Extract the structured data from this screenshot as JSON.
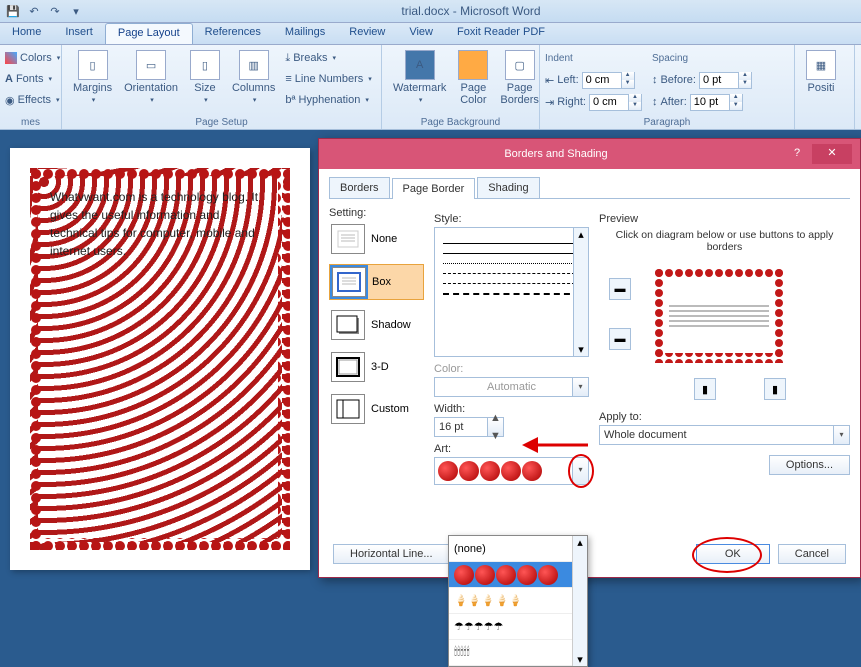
{
  "title": "trial.docx - Microsoft Word",
  "tabs": [
    "Home",
    "Insert",
    "Page Layout",
    "References",
    "Mailings",
    "Review",
    "View",
    "Foxit Reader PDF"
  ],
  "active_tab": 2,
  "themes_group": {
    "label": "mes",
    "colors": "Colors",
    "fonts": "Fonts",
    "effects": "Effects"
  },
  "page_setup": {
    "label": "Page Setup",
    "margins": "Margins",
    "orientation": "Orientation",
    "size": "Size",
    "columns": "Columns",
    "breaks": "Breaks",
    "line_numbers": "Line Numbers",
    "hyphenation": "Hyphenation"
  },
  "page_bg": {
    "label": "Page Background",
    "watermark": "Watermark",
    "page_color": "Page\nColor",
    "page_borders": "Page\nBorders"
  },
  "paragraph": {
    "label": "Paragraph",
    "indent": "Indent",
    "left": "Left:",
    "right": "Right:",
    "left_val": "0 cm",
    "right_val": "0 cm",
    "spacing": "Spacing",
    "before": "Before:",
    "after": "After:",
    "before_val": "0 pt",
    "after_val": "10 pt"
  },
  "arrange": {
    "position": "Positi"
  },
  "document_text": "Whatvwant.com is a technology blog. It gives the useful information and technical tips for computer, mobile and internet users.",
  "dialog": {
    "title": "Borders and Shading",
    "tabs": [
      "Borders",
      "Page Border",
      "Shading"
    ],
    "active": 1,
    "setting_label": "Setting:",
    "settings": [
      "None",
      "Box",
      "Shadow",
      "3-D",
      "Custom"
    ],
    "selected_setting": 1,
    "style_label": "Style:",
    "color_label": "Color:",
    "color_val": "Automatic",
    "width_label": "Width:",
    "width_val": "16 pt",
    "art_label": "Art:",
    "preview_label": "Preview",
    "preview_hint": "Click on diagram below or use buttons to apply borders",
    "apply_label": "Apply to:",
    "apply_val": "Whole document",
    "options": "Options...",
    "hline": "Horizontal Line...",
    "ok": "OK",
    "cancel": "Cancel",
    "art_none": "(none)"
  }
}
